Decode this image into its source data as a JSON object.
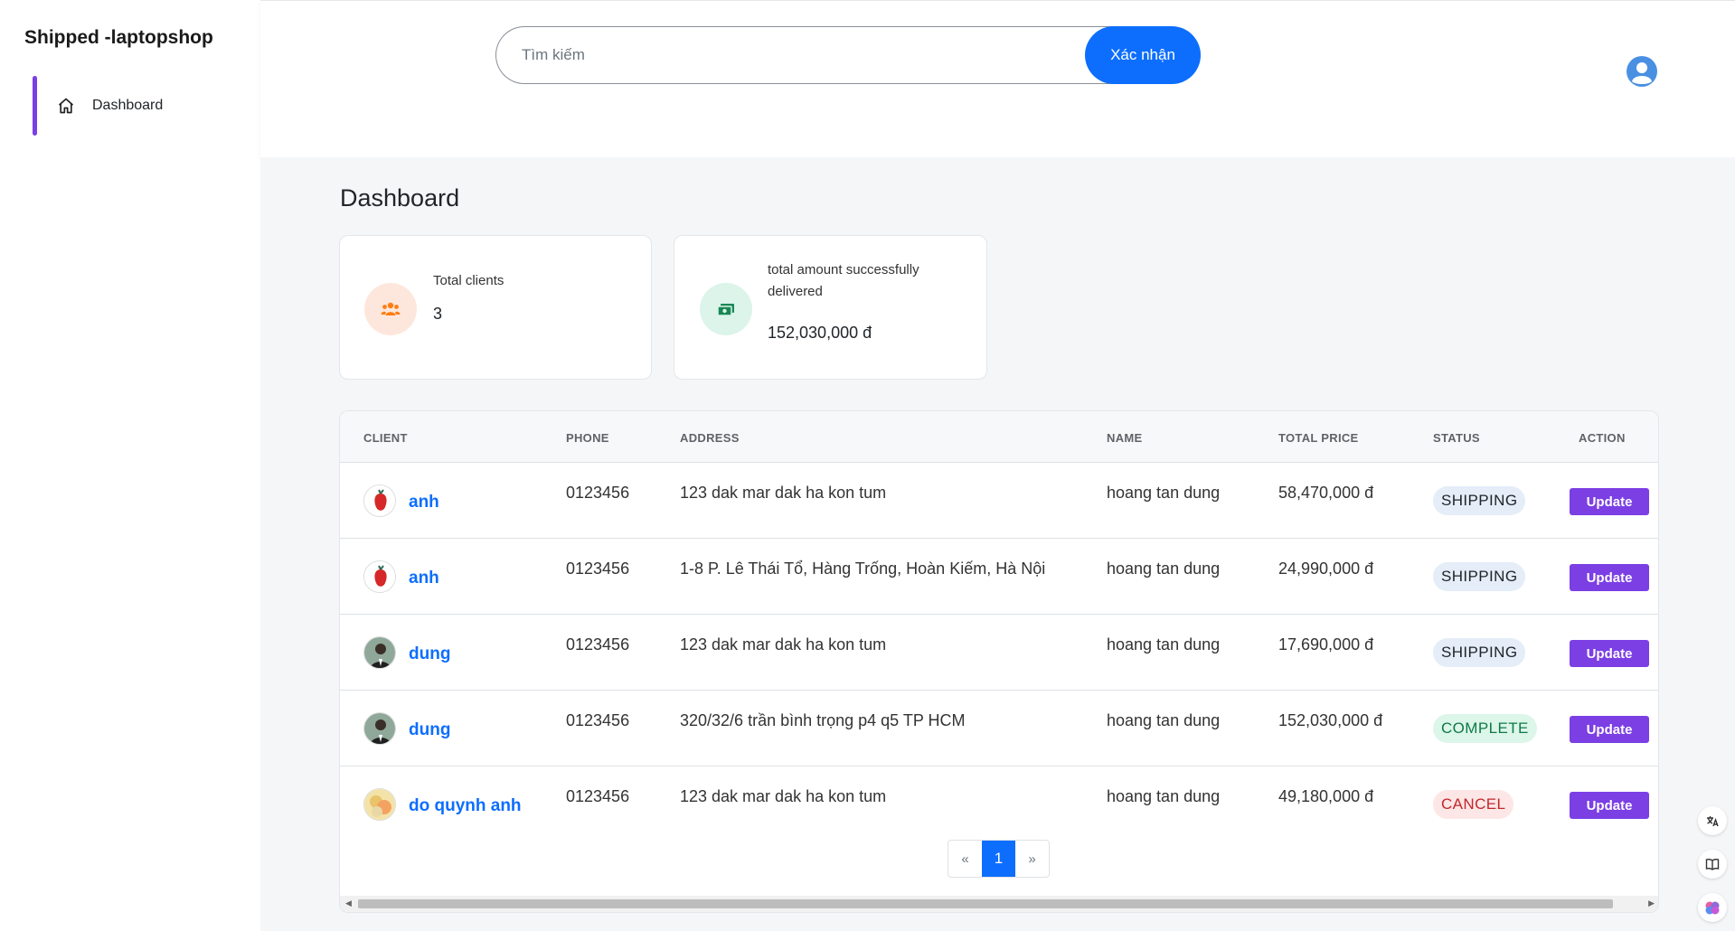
{
  "sidebar": {
    "brand": "Shipped -laptopshop",
    "items": [
      {
        "label": "Dashboard",
        "icon": "home-icon"
      }
    ]
  },
  "header": {
    "search": {
      "placeholder": "Tìm kiếm",
      "value": ""
    },
    "submit_label": "Xác nhận",
    "user_icon": "user-circle-icon"
  },
  "main": {
    "title": "Dashboard",
    "cards": [
      {
        "label": "Total clients",
        "value": "3",
        "icon": "users-icon",
        "color": "#fd7e14"
      },
      {
        "label": "total amount successfully delivered",
        "value": "152,030,000 đ",
        "icon": "money-icon",
        "color": "#198754"
      }
    ],
    "table": {
      "headers": [
        "CLIENT",
        "PHONE",
        "ADDRESS",
        "NAME",
        "TOTAL PRICE",
        "STATUS",
        "ACTION"
      ],
      "rows": [
        {
          "client": "anh",
          "phone": "0123456",
          "address": "123 dak mar dak ha kon tum",
          "name": "hoang tan dung",
          "total": "58,470,000 đ",
          "status": "SHIPPING",
          "action": "Update"
        },
        {
          "client": "anh",
          "phone": "0123456",
          "address": "1-8 P. Lê Thái Tổ, Hàng Trống, Hoàn Kiếm, Hà Nội",
          "name": "hoang tan dung",
          "total": "24,990,000 đ",
          "status": "SHIPPING",
          "action": "Update"
        },
        {
          "client": "dung",
          "phone": "0123456",
          "address": "123 dak mar dak ha kon tum",
          "name": "hoang tan dung",
          "total": "17,690,000 đ",
          "status": "SHIPPING",
          "action": "Update"
        },
        {
          "client": "dung",
          "phone": "0123456",
          "address": "320/32/6 trần bình trọng p4 q5 TP HCM",
          "name": "hoang tan dung",
          "total": "152,030,000 đ",
          "status": "COMPLETE",
          "action": "Update"
        },
        {
          "client": "do quynh anh",
          "phone": "0123456",
          "address": "123 dak mar dak ha kon tum",
          "name": "hoang tan dung",
          "total": "49,180,000 đ",
          "status": "CANCEL",
          "action": "Update"
        }
      ]
    },
    "pagination": {
      "prev": "«",
      "current": "1",
      "next": "»"
    }
  },
  "colors": {
    "primary": "#0d6efd",
    "accent": "#7b3fe4",
    "shipping_bg": "#e4edf8",
    "complete_bg": "#dcf6e9",
    "cancel_bg": "#fde6e6"
  }
}
